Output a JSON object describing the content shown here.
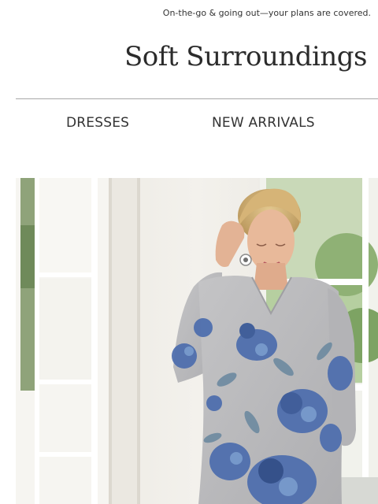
{
  "preheader": {
    "text": "On-the-go & going out—your plans are covered."
  },
  "brand": {
    "logo_text": "Soft Surroundings"
  },
  "nav": {
    "items": [
      {
        "label": "DRESSES"
      },
      {
        "label": "NEW ARRIVALS"
      }
    ]
  },
  "hero": {
    "icon": "woman-in-floral-tunic-photo"
  },
  "colors": {
    "background": "#ffffff",
    "text": "#333333",
    "divider": "#a8a8a8",
    "tunic_grey": "#b9b9bb",
    "floral_blue": "#4f6fae"
  }
}
